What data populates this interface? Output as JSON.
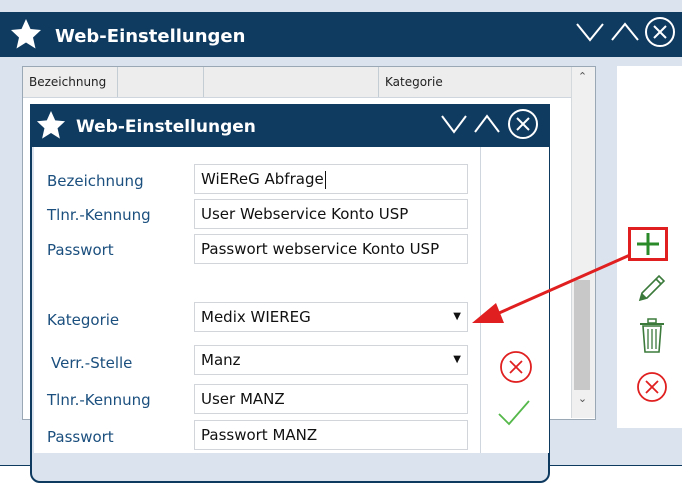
{
  "outer_window": {
    "title": "Web-Einstellungen",
    "columns": [
      "Bezeichnung",
      "",
      "",
      "Kategorie"
    ]
  },
  "inner_dialog": {
    "title": "Web-Einstellungen",
    "fields": {
      "bezeichnung": {
        "label": "Bezeichnung",
        "value": "WiEReG Abfrage"
      },
      "tlnr_kennung_1": {
        "label": "Tlnr.-Kennung",
        "value": "User Webservice Konto USP"
      },
      "passwort_1": {
        "label": "Passwort",
        "value": "Passwort webservice Konto USP"
      },
      "kategorie": {
        "label": "Kategorie",
        "value": "Medix WIEREG"
      },
      "verr_stelle": {
        "label": "Verr.-Stelle",
        "value": "Manz"
      },
      "tlnr_kennung_2": {
        "label": "Tlnr.-Kennung",
        "value": "User MANZ"
      },
      "passwort_2": {
        "label": "Passwort",
        "value": "Passwort MANZ"
      }
    }
  },
  "icons": {
    "star": "star-icon",
    "add": "plus-icon",
    "edit": "pencil-icon",
    "delete": "trash-icon",
    "cancel": "circle-x-icon",
    "ok": "checkmark-icon"
  },
  "colors": {
    "titlebar": "#0f3b61",
    "label": "#1b4f7e",
    "accent_green": "#2a8a2a",
    "cancel_red": "#e02020"
  }
}
